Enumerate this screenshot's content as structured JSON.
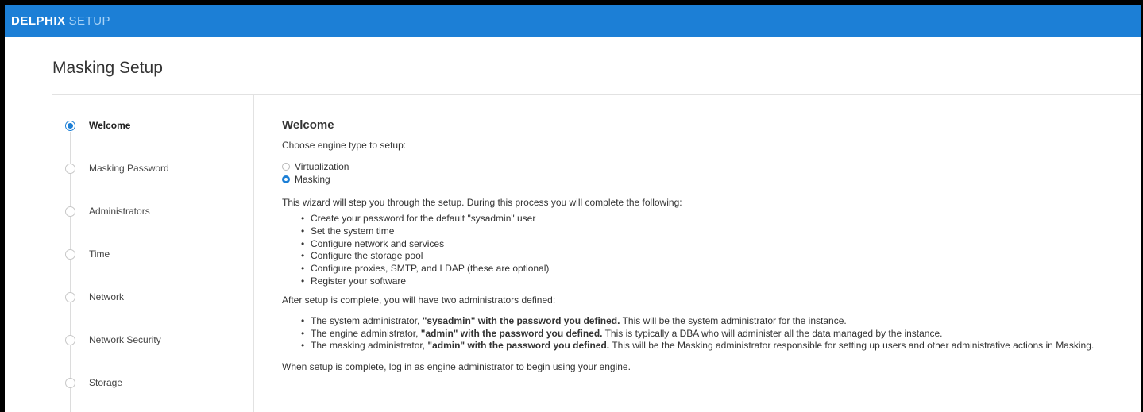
{
  "header": {
    "brand_bold": "DELPHIX",
    "brand_light": "SETUP",
    "color": "#1c7fd6"
  },
  "page": {
    "title": "Masking Setup"
  },
  "steps": [
    {
      "label": "Welcome",
      "active": true
    },
    {
      "label": "Masking Password",
      "active": false
    },
    {
      "label": "Administrators",
      "active": false
    },
    {
      "label": "Time",
      "active": false
    },
    {
      "label": "Network",
      "active": false
    },
    {
      "label": "Network Security",
      "active": false
    },
    {
      "label": "Storage",
      "active": false
    }
  ],
  "welcome": {
    "heading": "Welcome",
    "prompt": "Choose engine type to setup:",
    "options": [
      {
        "label": "Virtualization",
        "selected": false
      },
      {
        "label": "Masking",
        "selected": true
      }
    ],
    "intro": "This wizard will step you through the setup. During this process you will complete the following:",
    "tasks": [
      "Create your password for the default \"sysadmin\" user",
      "Set the system time",
      "Configure network and services",
      "Configure the storage pool",
      "Configure proxies, SMTP, and LDAP (these are optional)",
      "Register your software"
    ],
    "after": "After setup is complete, you will have two administrators defined:",
    "admins": [
      {
        "pre": "The system administrator, ",
        "bold": "\"sysadmin\" with the password you defined.",
        "post": " This will be the system administrator for the instance."
      },
      {
        "pre": "The engine administrator, ",
        "bold": "\"admin\" with the password you defined.",
        "post": " This is typically a DBA who will administer all the data managed by the instance."
      },
      {
        "pre": "The masking administrator, ",
        "bold": "\"admin\" with the password you defined.",
        "post": " This will be the Masking administrator responsible for setting up users and other administrative actions in Masking."
      }
    ],
    "final": "When setup is complete, log in as engine administrator to begin using your engine."
  }
}
